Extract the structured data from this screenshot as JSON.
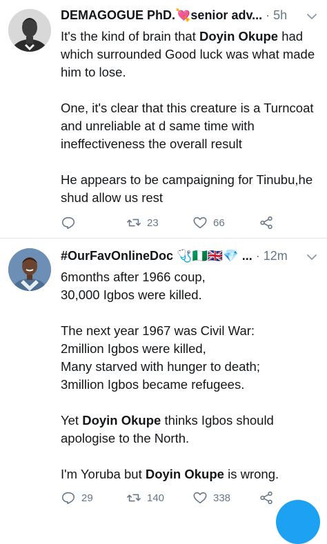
{
  "tweets": [
    {
      "author": "DEMAGOGUE PhD.💘senior adv...",
      "separator": "·",
      "time": "5h",
      "paragraphs": [
        [
          {
            "t": "It's the kind of brain that ",
            "b": false
          },
          {
            "t": "Doyin Okupe",
            "b": true
          },
          {
            "t": " had which surrounded Good luck was what made him to lose.",
            "b": false
          }
        ],
        [
          {
            "t": "One, it's clear that this creature is a Turncoat and unreliable at d same time with ineffectiveness the overall result",
            "b": false
          }
        ],
        [
          {
            "t": "He appears to be campaigning for Tinubu,he shud allow us rest",
            "b": false
          }
        ]
      ],
      "replies": "",
      "retweets": "23",
      "likes": "66"
    },
    {
      "author": "#OurFavOnlineDoc 🩺🇳🇬🇬🇧💎 ...",
      "separator": "·",
      "time": "12m",
      "paragraphs": [
        [
          {
            "t": "6months after 1966 coup,\n30,000 Igbos were killed.",
            "b": false
          }
        ],
        [
          {
            "t": "The next year 1967 was Civil War:\n2million Igbos were killed,\nMany starved with hunger to death;\n3million Igbos became refugees.",
            "b": false
          }
        ],
        [
          {
            "t": "Yet ",
            "b": false
          },
          {
            "t": "Doyin Okupe",
            "b": true
          },
          {
            "t": " thinks Igbos should apologise to the North.",
            "b": false
          }
        ],
        [
          {
            "t": "I'm Yoruba but ",
            "b": false
          },
          {
            "t": "Doyin Okupe",
            "b": true
          },
          {
            "t": " is wrong.",
            "b": false
          }
        ]
      ],
      "replies": "29",
      "retweets": "140",
      "likes": "338"
    }
  ],
  "icons": {
    "reply": "reply-icon",
    "retweet": "retweet-icon",
    "like": "heart-icon",
    "share": "share-icon",
    "caret": "chevron-down-icon"
  },
  "colors": {
    "text": "#14171a",
    "secondary": "#657786",
    "accent": "#1da1f2",
    "divider": "#e1e8ed"
  }
}
